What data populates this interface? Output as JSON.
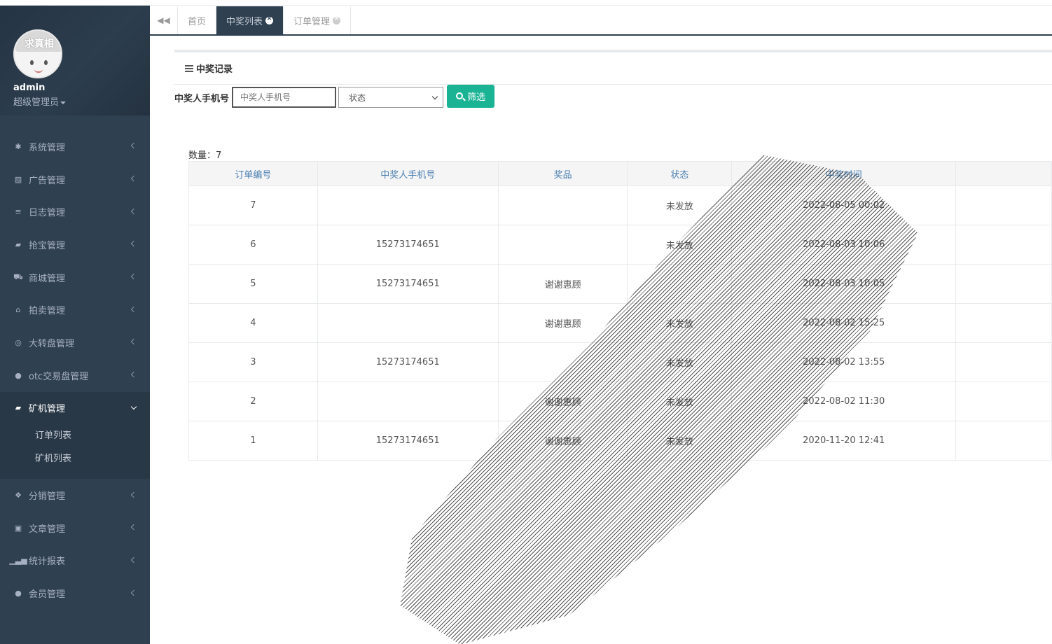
{
  "sidebar": {
    "avatar_text": "求真相",
    "username": "admin",
    "role": "超级管理员",
    "menu": [
      {
        "label": "系统管理",
        "icon": "gear-icon",
        "glyph": "✱"
      },
      {
        "label": "广告管理",
        "icon": "image-icon",
        "glyph": "▨"
      },
      {
        "label": "日志管理",
        "icon": "server-icon",
        "glyph": "≡"
      },
      {
        "label": "抢宝管理",
        "icon": "book-icon",
        "glyph": "▰"
      },
      {
        "label": "商城管理",
        "icon": "cart-icon",
        "glyph": "⛟"
      },
      {
        "label": "拍卖管理",
        "icon": "bank-icon",
        "glyph": "⌂"
      },
      {
        "label": "大转盘管理",
        "icon": "gamepad-icon",
        "glyph": "◎"
      },
      {
        "label": "otc交易盘管理",
        "icon": "user-icon",
        "glyph": "●"
      }
    ],
    "active_menu": {
      "label": "矿机管理",
      "icon": "book-icon",
      "glyph": "▰",
      "children": [
        "订单列表",
        "矿机列表"
      ]
    },
    "menu_after": [
      {
        "label": "分销管理",
        "icon": "cubes-icon",
        "glyph": "❖"
      },
      {
        "label": "文章管理",
        "icon": "archive-icon",
        "glyph": "▣"
      },
      {
        "label": "统计报表",
        "icon": "signal-icon",
        "glyph": "▁▃▅"
      },
      {
        "label": "会员管理",
        "icon": "user-icon",
        "glyph": "●"
      }
    ]
  },
  "tabs": {
    "back_icon": "double-left-icon",
    "items": [
      {
        "label": "首页",
        "active": false,
        "closable": false
      },
      {
        "label": "中奖列表",
        "active": true,
        "closable": true
      },
      {
        "label": "订单管理",
        "active": false,
        "closable": true
      }
    ]
  },
  "panel": {
    "title": "中奖记录"
  },
  "filter": {
    "label": "中奖人手机号",
    "phone_placeholder": "中奖人手机号",
    "status_selected": "状态",
    "search_label": "筛选"
  },
  "count_text": "数量：7",
  "table": {
    "columns": [
      "订单编号",
      "中奖人手机号",
      "奖品",
      "状态",
      "中奖时间",
      ""
    ],
    "rows": [
      [
        "7",
        "",
        "",
        "未发放",
        "2022-08-05 00:02",
        ""
      ],
      [
        "6",
        "15273174651",
        "",
        "未发放",
        "2022-08-03 10:06",
        ""
      ],
      [
        "5",
        "15273174651",
        "谢谢惠顾",
        "",
        "2022-08-03 10:05",
        ""
      ],
      [
        "4",
        "",
        "谢谢惠顾",
        "未发放",
        "2022-08-02 15:25",
        ""
      ],
      [
        "3",
        "15273174651",
        "",
        "未发放",
        "2022-08-02 13:55",
        ""
      ],
      [
        "2",
        "",
        "谢谢惠顾",
        "未发放",
        "2022-08-02 11:30",
        ""
      ],
      [
        "1",
        "15273174651",
        "谢谢惠顾",
        "未发放",
        "2020-11-20 12:41",
        ""
      ]
    ]
  },
  "colors": {
    "sidebar_bg": "#2f4050",
    "accent": "#1ab394",
    "header_text": "#4a7fb0"
  }
}
